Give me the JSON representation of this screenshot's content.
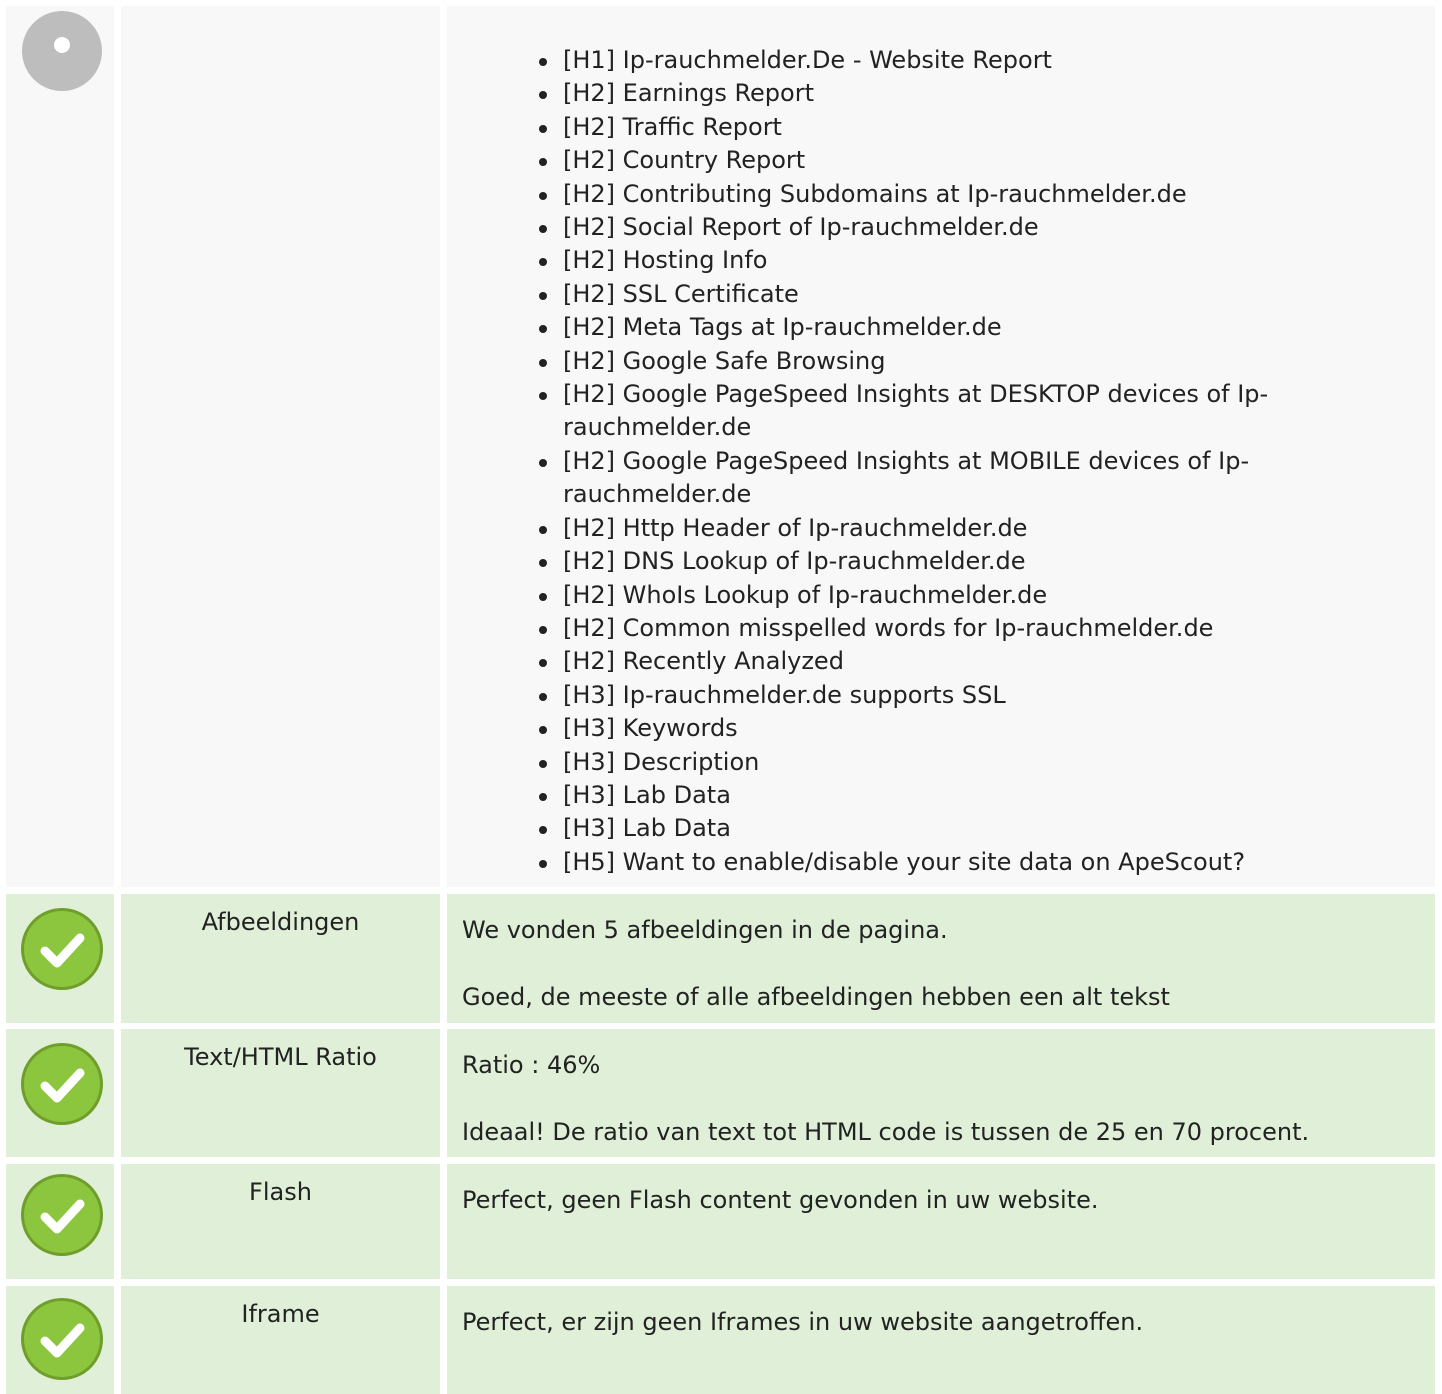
{
  "headings_section": {
    "icon": "neutral-circle-icon",
    "items": [
      "[H1] Ip-rauchmelder.De - Website Report",
      "[H2] Earnings Report",
      "[H2] Traffic Report",
      "[H2] Country Report",
      "[H2] Contributing Subdomains at Ip-rauchmelder.de",
      "[H2] Social Report of Ip-rauchmelder.de",
      "[H2] Hosting Info",
      "[H2] SSL Certificate",
      "[H2] Meta Tags at Ip-rauchmelder.de",
      "[H2] Google Safe Browsing",
      "[H2] Google PageSpeed Insights at DESKTOP devices of Ip-rauchmelder.de",
      "[H2] Google PageSpeed Insights at MOBILE devices of Ip-rauchmelder.de",
      "[H2] Http Header of Ip-rauchmelder.de",
      "[H2] DNS Lookup of Ip-rauchmelder.de",
      "[H2] WhoIs Lookup of Ip-rauchmelder.de",
      "[H2] Common misspelled words for Ip-rauchmelder.de",
      "[H2] Recently Analyzed",
      "[H3] Ip-rauchmelder.de supports SSL",
      "[H3] Keywords",
      "[H3] Description",
      "[H3] Lab Data",
      "[H3] Lab Data",
      "[H5] Want to enable/disable your site data on ApeScout?"
    ]
  },
  "rows": [
    {
      "status": "pass",
      "icon": "checkmark-icon",
      "label": "Afbeeldingen",
      "line1": "We vonden 5 afbeeldingen in de pagina.",
      "line2": "Goed, de meeste of alle afbeeldingen hebben een alt tekst"
    },
    {
      "status": "pass",
      "icon": "checkmark-icon",
      "label": "Text/HTML Ratio",
      "line1": "Ratio : 46%",
      "line2": "Ideaal! De ratio van text tot HTML code is tussen de 25 en 70 procent."
    },
    {
      "status": "pass",
      "icon": "checkmark-icon",
      "label": "Flash",
      "line1": "Perfect, geen Flash content gevonden in uw website.",
      "line2": ""
    },
    {
      "status": "pass",
      "icon": "checkmark-icon",
      "label": "Iframe",
      "line1": "Perfect, er zijn geen Iframes in uw website aangetroffen.",
      "line2": ""
    }
  ],
  "colors": {
    "neutral_bg": "#f8f8f8",
    "pass_bg": "#e0f0d8",
    "check_green": "#8cc63f",
    "neutral_icon": "#bdbdbd"
  }
}
